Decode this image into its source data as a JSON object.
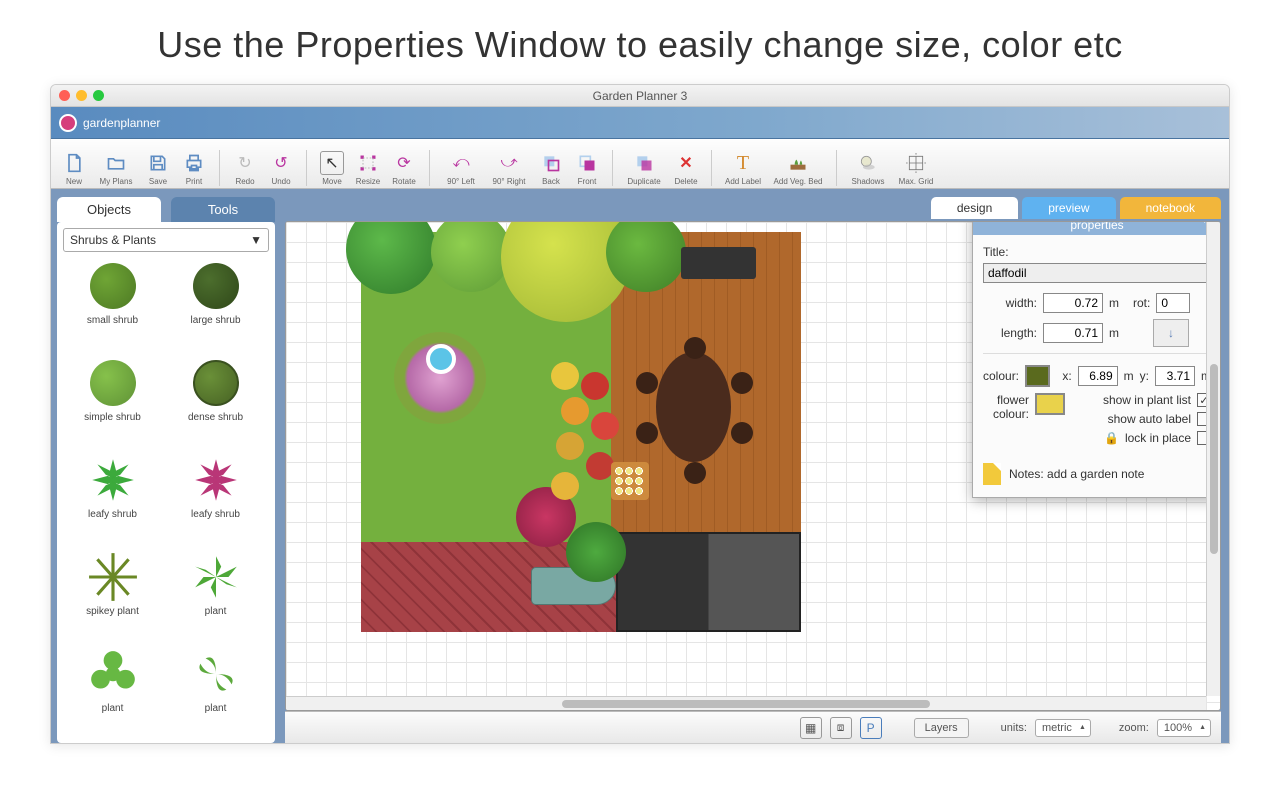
{
  "bannerText": "Use the Properties Window to easily change size, color etc",
  "windowTitle": "Garden Planner 3",
  "appName": "gardenplanner",
  "toolbar": {
    "new": "New",
    "myplans": "My Plans",
    "save": "Save",
    "print": "Print",
    "redo": "Redo",
    "undo": "Undo",
    "move": "Move",
    "resize": "Resize",
    "rotate": "Rotate",
    "left90": "90° Left",
    "right90": "90° Right",
    "back": "Back",
    "front": "Front",
    "duplicate": "Duplicate",
    "delete": "Delete",
    "addlabel": "Add Label",
    "addvegbed": "Add Veg. Bed",
    "shadows": "Shadows",
    "maxgrid": "Max. Grid"
  },
  "leftTabs": {
    "objects": "Objects",
    "tools": "Tools"
  },
  "categoryDropdown": "Shrubs & Plants",
  "objects": {
    "smallShrub": "small shrub",
    "largeShrub": "large shrub",
    "simpleShrub": "simple shrub",
    "denseShrub": "dense shrub",
    "leafyShrub1": "leafy shrub",
    "leafyShrub2": "leafy shrub",
    "spikeyPlant": "spikey plant",
    "plant1": "plant",
    "plant2": "plant",
    "plant3": "plant"
  },
  "viewTabs": {
    "design": "design",
    "preview": "preview",
    "notebook": "notebook"
  },
  "properties": {
    "header": "properties",
    "titleLabel": "Title:",
    "titleValue": "daffodil",
    "widthLabel": "width:",
    "widthValue": "0.72",
    "widthUnit": "m",
    "lengthLabel": "length:",
    "lengthValue": "0.71",
    "lengthUnit": "m",
    "rotLabel": "rot:",
    "rotValue": "0",
    "colourLabel": "colour:",
    "colourHex": "#5a6a1e",
    "xLabel": "x:",
    "xValue": "6.89",
    "xyUnit": "m",
    "yLabel": "y:",
    "yValue": "3.71",
    "flowerColourLabel": "flower colour:",
    "flowerColourHex": "#e9d24b",
    "showPlantList": "show in plant list",
    "showPlantListChecked": "✓",
    "showAutoLabel": "show auto label",
    "lockInPlace": "lock in place",
    "notesLabel": "Notes: add a garden note"
  },
  "bottom": {
    "layers": "Layers",
    "unitsLabel": "units:",
    "unitsValue": "metric",
    "zoomLabel": "zoom:",
    "zoomValue": "100%"
  }
}
